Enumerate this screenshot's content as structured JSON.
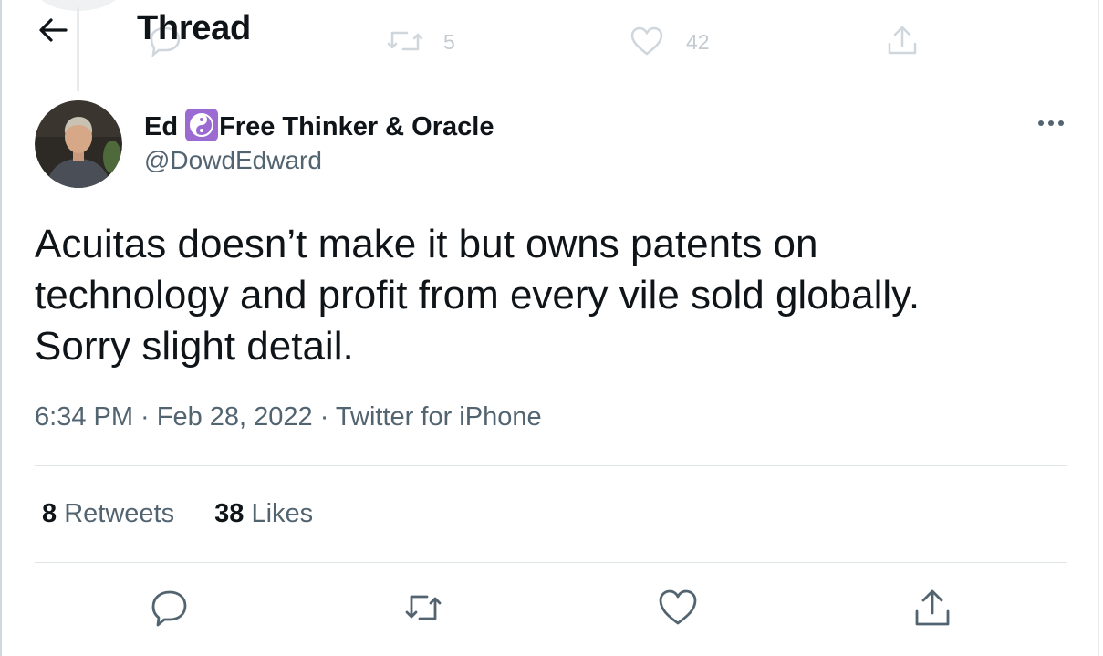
{
  "header": {
    "title": "Thread"
  },
  "background_tweet": {
    "retweets": "5",
    "likes": "42"
  },
  "tweet": {
    "author": {
      "name": "Ed",
      "name_suffix": "Free Thinker & Oracle",
      "emoji_icon": "yin-yang-icon",
      "handle": "@DowdEdward"
    },
    "text_lines": [
      "Acuitas doesn’t make it but owns patents on",
      "technology and profit from every vile sold globally.",
      "Sorry slight detail."
    ],
    "timestamp": "6:34 PM · Feb 28, 2022 · Twitter for iPhone",
    "retweet_count": "8",
    "retweet_label": "Retweets",
    "like_count": "38",
    "like_label": "Likes"
  },
  "actions": [
    "reply-icon",
    "retweet-icon",
    "like-icon",
    "share-icon"
  ],
  "colors": {
    "text": "#0f1419",
    "secondary": "#536471",
    "divider": "#dfe4e7",
    "emoji_bg": "#9b6bd1"
  }
}
